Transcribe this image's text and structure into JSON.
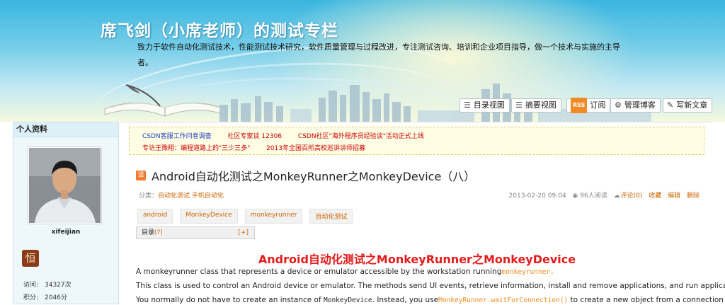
{
  "banner": {
    "title": "席飞剑（小席老师）的测试专栏",
    "description": "致力于软件自动化测试技术，性能测试技术研究，软件质量管理与过程改进，专注测试咨询、培训和企业项目指导，做一个技术与实施的主导者。",
    "toolbar": {
      "catalog_view": "目录视图",
      "summary_view": "摘要视图",
      "rss_badge": "RSS",
      "subscribe": "订阅",
      "manage_blog": "管理博客",
      "write_article": "写新文章"
    }
  },
  "sidebar": {
    "heading": "个人资料",
    "username": "xifeijian",
    "badge_char": "恒",
    "stats": [
      {
        "label": "访问:",
        "value": "34327次"
      },
      {
        "label": "积分:",
        "value": "2046分"
      }
    ]
  },
  "notices": {
    "row1": [
      "CSDN客服工作问卷调查",
      "社区专家谈 12306",
      "CSDN社区\"海外程序员经验谈\"活动正式上线"
    ],
    "row2": [
      "专访王豫翔：编程道路上的\"三少三多\"",
      "2013年全国百所高校巡讲讲师招募"
    ]
  },
  "article": {
    "type_badge": "译",
    "title": "Android自动化测试之MonkeyRunner之MonkeyDevice（八）",
    "category_label": "分类：",
    "category_value": "自动化测试 手机自动化",
    "date": "2013-02-20 09:04",
    "reads": "96人阅读",
    "comments": "评论(0)",
    "favorite": "收藏",
    "edit": "编辑",
    "delete": "删除",
    "tags": [
      "android",
      "MonkeyDevice",
      "monkeyrunner",
      "自动化测试"
    ],
    "toc_label": "目录",
    "toc_question": "(?)",
    "toc_expand": "[+]",
    "heading": "Android自动化测试之MonkeyRunner之MonkeyDevice",
    "p1_text": "A monkeyrunner class that represents a device or emulator accessible by the workstation running",
    "p1_code": "monkeyrunner.",
    "p2_text": "This class is used to control an Android device or emulator. The methods send UI events, retrieve information, install and remove applications, and run applications.",
    "p3_a": "You normally do not have to create an instance of ",
    "p3_code1": "MonkeyDevice",
    "p3_b": ". Instead, you use",
    "p3_code2": "MonkeyRunner.waitForConnection()",
    "p3_c": " to create a new object from a connection"
  }
}
